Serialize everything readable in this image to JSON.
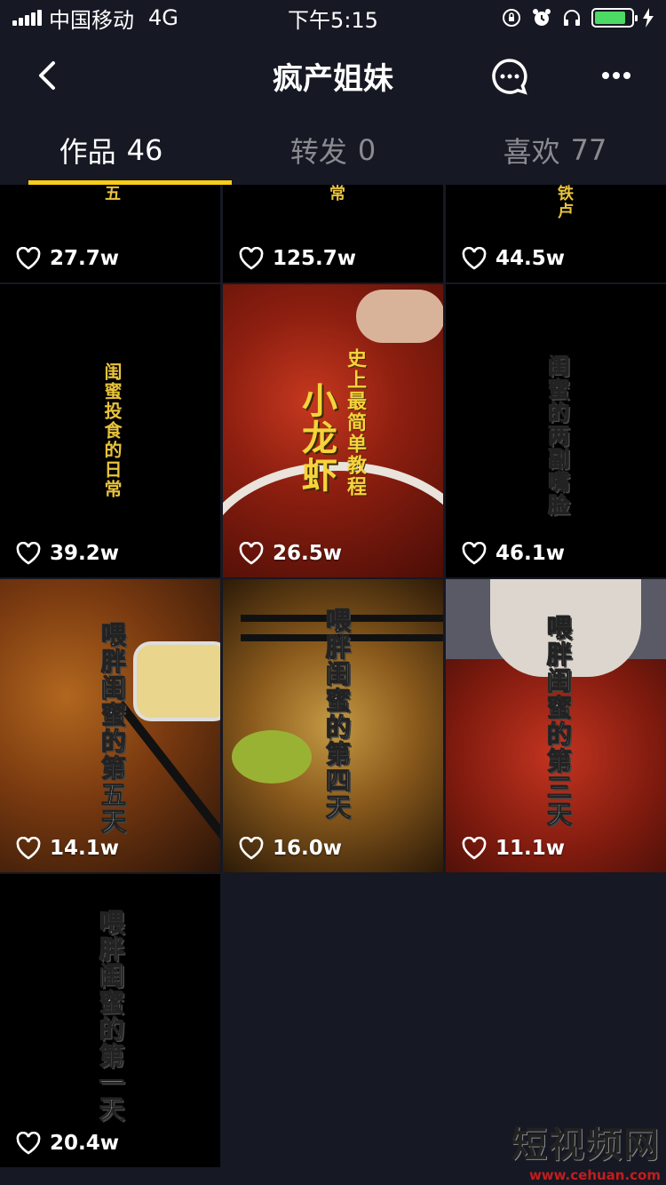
{
  "status": {
    "carrier": "中国移动",
    "network": "4G",
    "time": "下午5:15"
  },
  "header": {
    "title": "疯产姐妹"
  },
  "tabs": [
    {
      "label": "作品",
      "count": "46"
    },
    {
      "label": "转发",
      "count": "0"
    },
    {
      "label": "喜欢",
      "count": "77"
    }
  ],
  "videos": [
    {
      "likes": "27.7w",
      "caption": "五"
    },
    {
      "likes": "125.7w",
      "caption": "常"
    },
    {
      "likes": "44.5w",
      "caption": "铁卢"
    },
    {
      "likes": "39.2w",
      "caption": "闺蜜投食的日常"
    },
    {
      "likes": "26.5w",
      "caption_big": "小龙虾",
      "caption_small": "史上最简单教程"
    },
    {
      "likes": "46.1w",
      "caption": "闺蜜的两副嘴脸"
    },
    {
      "likes": "14.1w",
      "caption": "喂胖闺蜜的第五天"
    },
    {
      "likes": "16.0w",
      "caption": "喂胖闺蜜的第四天"
    },
    {
      "likes": "11.1w",
      "caption": "喂胖闺蜜的第三天"
    },
    {
      "likes": "20.4w",
      "caption": "喂胖闺蜜的第一天"
    }
  ],
  "watermark": {
    "title": "短视频网",
    "url": "www.cehuan.com"
  },
  "colors": {
    "background": "#161823",
    "accent": "#face15"
  }
}
